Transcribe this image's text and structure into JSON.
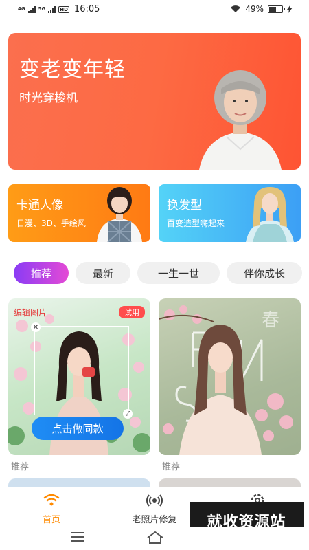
{
  "status_bar": {
    "net1": "4G",
    "net2": "5G",
    "hd": "HD",
    "time": "16:05",
    "battery": "49%",
    "battery_level": 0.49
  },
  "hero": {
    "title": "变老变年轻",
    "subtitle": "时光穿梭机"
  },
  "features": [
    {
      "title": "卡通人像",
      "subtitle": "日漫、3D、手绘风"
    },
    {
      "title": "换发型",
      "subtitle": "百变造型嗨起来"
    }
  ],
  "tabs": [
    "推荐",
    "最新",
    "一生一世",
    "伴你成长"
  ],
  "cards": {
    "left": {
      "edit_label": "编辑图片",
      "badge": "试用",
      "cta": "点击做同款",
      "caption": "推荐"
    },
    "right": {
      "caption": "推荐"
    }
  },
  "bottom_nav": {
    "home": "首页",
    "repair": "老照片修复"
  },
  "watermark": "就收资源站",
  "colors": {
    "hero": "#fd6a43",
    "cartoon": "#ff8a14",
    "hair": "#3ca8f5",
    "tab_active": "#b042e8",
    "cta": "#1a82f0",
    "nav_active": "#ff8a00"
  }
}
